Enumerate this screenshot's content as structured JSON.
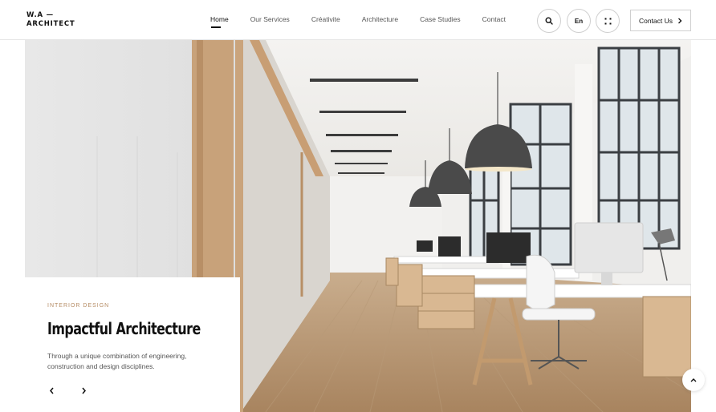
{
  "brand": {
    "line1": "W.A —",
    "line2": "ARCHITECT"
  },
  "nav": {
    "items": [
      {
        "label": "Home",
        "active": true
      },
      {
        "label": "Our Services",
        "active": false
      },
      {
        "label": "Créativite",
        "active": false
      },
      {
        "label": "Architecture",
        "active": false
      },
      {
        "label": "Case Studies",
        "active": false
      },
      {
        "label": "Contact",
        "active": false
      }
    ]
  },
  "header_actions": {
    "search_icon": "search-icon",
    "language_label": "En",
    "grid_icon": "grid-dots-icon",
    "contact_label": "Contact Us",
    "contact_icon": "chevron-right-icon"
  },
  "hero": {
    "image_description_icon": "office-interior-photo",
    "eyebrow": "INTERIOR DESIGN",
    "title": "Impactful Architecture",
    "description": "Through a unique combination of engineering, construction and design disciplines.",
    "prev_icon": "chevron-left-icon",
    "next_icon": "chevron-right-icon"
  },
  "scroll_top_icon": "chevron-up-icon",
  "colors": {
    "accent": "#b58b63",
    "text": "#111111",
    "muted": "#555555",
    "border": "#cfcfcf"
  }
}
